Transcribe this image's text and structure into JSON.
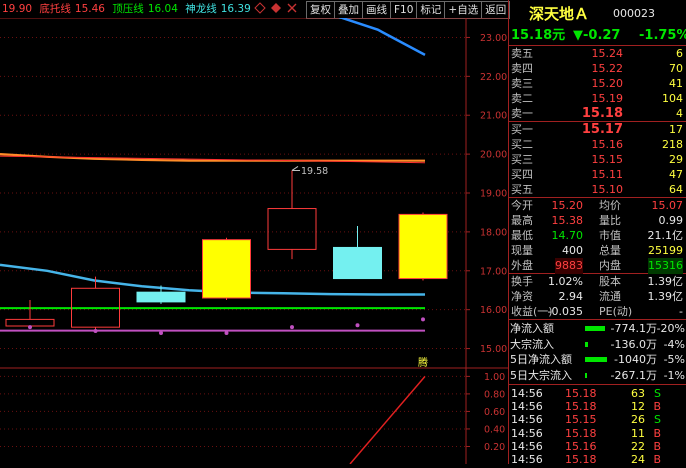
{
  "legend": {
    "first_value": "19.90",
    "items": [
      {
        "label": "底托线",
        "value": "15.46"
      },
      {
        "label": "顶压线",
        "value": "16.04"
      },
      {
        "label": "神龙线",
        "value": "16.39"
      }
    ],
    "icons": [
      "diamond-icon",
      "settings-icon",
      "close-icon"
    ]
  },
  "toolbar": [
    "复权",
    "叠加",
    "画线",
    "F10",
    "标记",
    "+自选",
    "返回"
  ],
  "chart": {
    "y_ticks": [
      "23.00",
      "22.00",
      "21.00",
      "20.00",
      "19.00",
      "18.00",
      "17.00",
      "16.00",
      "15.00"
    ],
    "y_range": [
      14.5,
      23.5
    ],
    "max_label": "19.58",
    "x_axis_label": "腾",
    "lower_ticks": [
      "1.00",
      "0.80",
      "0.60",
      "0.40",
      "0.20"
    ],
    "lower_range": [
      0,
      1.05
    ],
    "candles": [
      {
        "open": 15.75,
        "close": 15.58,
        "high": 16.25,
        "low": 15.55,
        "color": "red-hollow"
      },
      {
        "open": 15.55,
        "close": 16.55,
        "high": 16.85,
        "low": 15.5,
        "color": "red-hollow"
      },
      {
        "open": 16.2,
        "close": 16.45,
        "high": 16.62,
        "low": 16.15,
        "color": "cyan"
      },
      {
        "open": 16.3,
        "close": 17.8,
        "high": 17.85,
        "low": 16.25,
        "color": "yellow"
      },
      {
        "open": 17.55,
        "close": 18.6,
        "high": 19.58,
        "low": 17.3,
        "color": "red-hollow"
      },
      {
        "open": 16.8,
        "close": 17.6,
        "high": 18.15,
        "low": 16.8,
        "color": "cyan"
      },
      {
        "open": 16.8,
        "close": 18.45,
        "high": 18.5,
        "low": 16.75,
        "color": "yellow"
      }
    ],
    "lines": {
      "blue_top": [
        23.7,
        23.7,
        23.7,
        23.7,
        23.7,
        23.7,
        23.7,
        23.6,
        23.2,
        22.55
      ],
      "orange": [
        20.0,
        19.93,
        19.88,
        19.85,
        19.83,
        19.83,
        19.83,
        19.83,
        19.83,
        19.83
      ],
      "cyan": [
        17.15,
        17.0,
        16.75,
        16.6,
        16.5,
        16.44,
        16.42,
        16.4,
        16.39,
        16.39
      ],
      "green": 16.04,
      "magenta": 15.46
    },
    "dots": [
      15.55,
      15.45,
      15.4,
      15.4,
      15.55,
      15.6,
      15.75
    ],
    "lower_line": [
      [
        350,
        0
      ],
      [
        425,
        1.0
      ]
    ]
  },
  "stock": {
    "name": "深天地Ａ",
    "code": "000023",
    "price": "15.18元",
    "change": "▼-0.27",
    "pct": "-1.75%"
  },
  "sells": [
    {
      "label": "卖五",
      "price": "15.24",
      "vol": "6"
    },
    {
      "label": "卖四",
      "price": "15.22",
      "vol": "70"
    },
    {
      "label": "卖三",
      "price": "15.20",
      "vol": "41"
    },
    {
      "label": "卖二",
      "price": "15.19",
      "vol": "104"
    },
    {
      "label": "卖一",
      "price": "15.18",
      "vol": "4"
    }
  ],
  "buys": [
    {
      "label": "买一",
      "price": "15.17",
      "vol": "17"
    },
    {
      "label": "买二",
      "price": "15.16",
      "vol": "218"
    },
    {
      "label": "买三",
      "price": "15.15",
      "vol": "29"
    },
    {
      "label": "买四",
      "price": "15.11",
      "vol": "47"
    },
    {
      "label": "买五",
      "price": "15.10",
      "vol": "64"
    }
  ],
  "stats": [
    {
      "l1": "今开",
      "v1": "15.20",
      "l2": "均价",
      "v2": "15.07"
    },
    {
      "l1": "最高",
      "v1": "15.38",
      "l2": "量比",
      "v2": "0.99"
    },
    {
      "l1": "最低",
      "v1": "14.70",
      "l2": "市值",
      "v2": "21.1亿"
    },
    {
      "l1": "现量",
      "v1": "400",
      "l2": "总量",
      "v2": "25199"
    },
    {
      "l1": "外盘",
      "v1": "9883",
      "l2": "内盘",
      "v2": "15316"
    }
  ],
  "stats2": [
    {
      "l1": "换手",
      "v1": "1.02%",
      "l2": "股本",
      "v2": "1.39亿"
    },
    {
      "l1": "净资",
      "v1": "2.94",
      "l2": "流通",
      "v2": "1.39亿"
    },
    {
      "l1": "收益(一)",
      "v1": "-0.035",
      "l2": "PE(动)",
      "v2": "-"
    }
  ],
  "flows": [
    {
      "label": "净流入额",
      "value": "-774.1万",
      "pct": "-20%",
      "bar": 0.55
    },
    {
      "label": "大宗流入",
      "value": "-136.0万",
      "pct": "-4%",
      "bar": 0.08
    },
    {
      "label": "5日净流入额",
      "value": "-1040万",
      "pct": "-5%",
      "bar": 0.6
    },
    {
      "label": "5日大宗流入",
      "value": "-267.1万",
      "pct": "-1%",
      "bar": 0.05
    }
  ],
  "ticks": [
    {
      "time": "14:56",
      "price": "15.18",
      "vol": "63",
      "side": "S"
    },
    {
      "time": "14:56",
      "price": "15.18",
      "vol": "12",
      "side": "B"
    },
    {
      "time": "14:56",
      "price": "15.15",
      "vol": "26",
      "side": "S"
    },
    {
      "time": "14:56",
      "price": "15.18",
      "vol": "11",
      "side": "B"
    },
    {
      "time": "14:56",
      "price": "15.16",
      "vol": "22",
      "side": "B"
    },
    {
      "time": "14:56",
      "price": "15.18",
      "vol": "24",
      "side": "B"
    }
  ]
}
